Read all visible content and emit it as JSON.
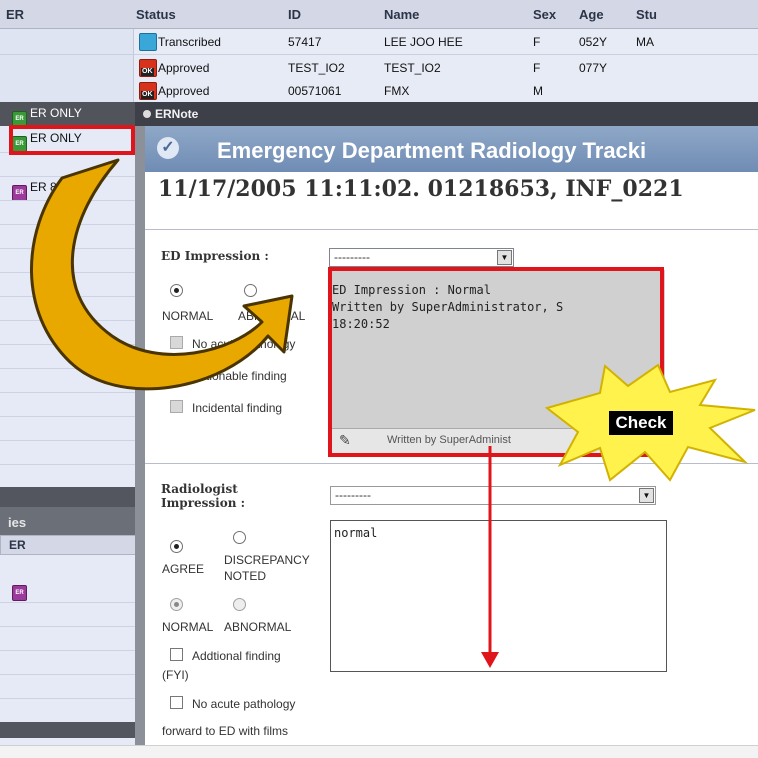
{
  "worklist": {
    "columns": [
      "ER",
      "Status",
      "ID",
      "Name",
      "Sex",
      "Age",
      "Stu"
    ],
    "rows": [
      {
        "status": "Transcribed",
        "status_icon": "transcribed-icon",
        "id": "57417",
        "name": "LEE JOO HEE",
        "sex": "F",
        "age": "052Y",
        "study": "MA"
      },
      {
        "status": "Approved",
        "status_icon": "approved-icon",
        "id": "TEST_IO2",
        "name": "TEST_IO2",
        "sex": "F",
        "age": "077Y",
        "study": ""
      },
      {
        "status": "Approved",
        "status_icon": "approved-icon",
        "id": "00571061",
        "name": "FMX",
        "sex": "M",
        "age": "",
        "study": ""
      }
    ]
  },
  "sidebar": {
    "items": [
      {
        "label": "ER ONLY",
        "tag": "ER",
        "color": "#3a9a3a"
      },
      {
        "label": "ER ONLY",
        "tag": "ER",
        "color": "#3a9a3a",
        "highlighted": true
      },
      {
        "label": "ER 8",
        "tag": "ER",
        "color": "#9c3b9c"
      }
    ],
    "section_title": "ies",
    "column_header": "ER",
    "lower_item_tag": "ER"
  },
  "ernote": {
    "window_title": "ERNote",
    "banner_title": "Emergency Department Radiology Tracki",
    "note_header": "11/17/2005 11:11:02. 01218653, INF_0221",
    "ed_impression": {
      "label": "ED Impression :",
      "dropdown_value": "---------",
      "radio_normal": "NORMAL",
      "radio_abnormal": "ABNORMAL",
      "checks": [
        "No acute pathology",
        "Actionable finding",
        "Incidental finding"
      ],
      "text_lines": [
        "ED Impression : Normal",
        "Written by SuperAdministrator, S",
        "18:20:52"
      ],
      "footer_text": "Written by SuperAdminist"
    },
    "radiologist_impression": {
      "label_line1": "Radiologist",
      "label_line2": "Impression :",
      "dropdown_value": "---------",
      "agree": "AGREE",
      "discrepancy_line1": "DISCREPANCY",
      "discrepancy_line2": "NOTED",
      "normal": "NORMAL",
      "abnormal": "ABNORMAL",
      "additional_line1": "Addtional finding",
      "additional_line2": "(FYI)",
      "no_acute": "No acute pathology",
      "forward": "forward to ED with films",
      "text": "normal"
    }
  },
  "annotation": {
    "check_label": "Check",
    "highlight_color": "#e0141b",
    "arrow_color": "#e8a800",
    "starburst_color": "#fff24d"
  }
}
